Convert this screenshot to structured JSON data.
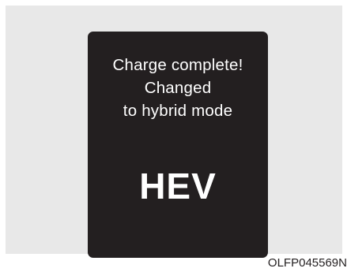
{
  "display": {
    "message_lines": [
      "Charge complete!",
      "Changed",
      "to hybrid mode"
    ],
    "mode": "HEV"
  },
  "figure_code": "OLFP045569N",
  "colors": {
    "background": "#e8e8e8",
    "screen": "#231f20",
    "text": "#ffffff"
  }
}
